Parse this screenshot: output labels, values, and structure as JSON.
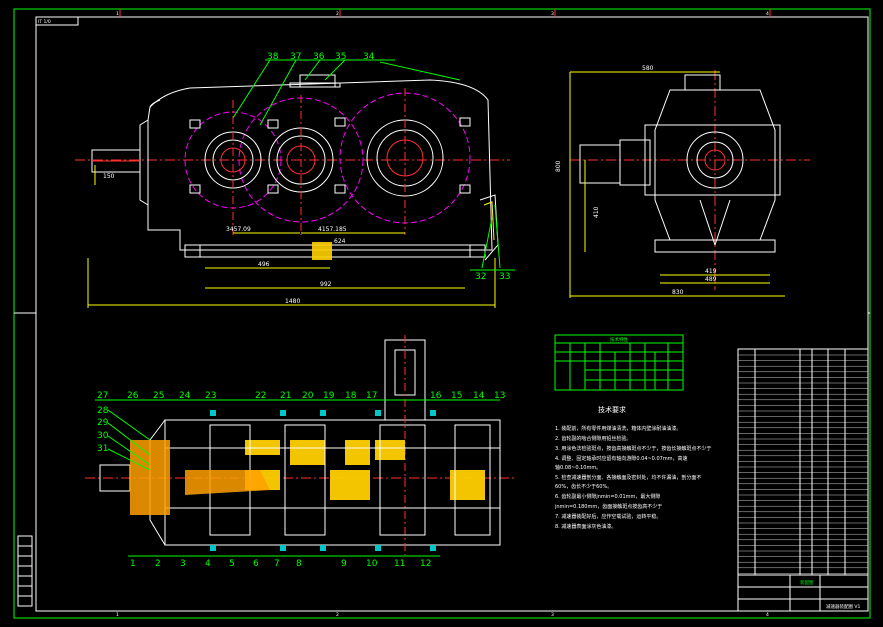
{
  "title_block": {
    "top_left_tag": "IT 1/0"
  },
  "border_numbers": {
    "top": [
      "1",
      "2",
      "3",
      "4"
    ],
    "bottom": [
      "1",
      "2",
      "3",
      "4"
    ]
  },
  "front_view": {
    "balloons": [
      "38",
      "37",
      "36",
      "35",
      "34",
      "32",
      "33"
    ],
    "dims": {
      "d150": "150",
      "d3457": "3457.09",
      "d4157": "4157.185",
      "d624": "624",
      "d496": "496",
      "d992": "992",
      "d1480": "1480"
    }
  },
  "side_view": {
    "dims": {
      "d580": "580",
      "d800": "800",
      "d410": "410",
      "d419": "419",
      "d489": "489",
      "d830": "830"
    }
  },
  "plan_view": {
    "balloons_top": [
      "27",
      "26",
      "25",
      "24",
      "23",
      "22",
      "21",
      "20",
      "19",
      "18",
      "17",
      "16",
      "15",
      "14",
      "13"
    ],
    "balloons_left": [
      "28",
      "29",
      "30",
      "31"
    ],
    "balloons_bottom": [
      "1",
      "2",
      "3",
      "4",
      "5",
      "6",
      "7",
      "8",
      "9",
      "10",
      "11",
      "12"
    ]
  },
  "tech_notes": {
    "heading": "技术要求",
    "lines": [
      "1. 装配前，所有零件用煤油清洗，箱体内壁涂耐油油漆。",
      "2. 齿轮副的啮合侧隙用铅丝检验。",
      "3. 用涂色法检验斑点，按齿高接触斑点不少于，按齿长接触斑点不少于",
      "4. 调整、固定轴承时应留有轴向游隙0.04~0.07mm，高速",
      "轴0.08~0.10mm。",
      "5. 检查减速器剖分面、各接触面及密封处，均不许漏油，剖分面不",
      "60%，齿长不少于60%。",
      "6. 齿轮副最小侧隙jnmin=0.01mm，最大侧隙",
      "jnmin=0.180mm，齿面接触斑点按齿高不少于",
      "7. 减速器装配好后，应作空载试验，运转平稳。",
      "8. 减速器表面涂灰色油漆。"
    ]
  },
  "spec_table": {
    "title": "技术特性"
  },
  "title_block_bottom": {
    "drawing_name": "装配图",
    "footer": "减速器装配图 V1"
  }
}
